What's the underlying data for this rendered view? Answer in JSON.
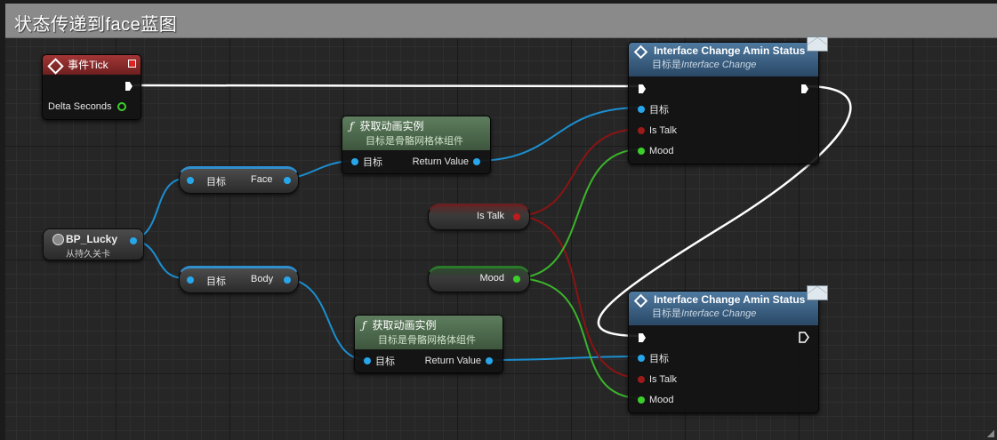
{
  "comment": {
    "title": "状态传递到face蓝图"
  },
  "event_tick": {
    "title": "事件Tick",
    "delta_label": "Delta Seconds"
  },
  "bp_lucky": {
    "name": "BP_Lucky",
    "subtitle": "从持久关卡"
  },
  "face_getter": {
    "target_label": "目标",
    "output_label": "Face"
  },
  "body_getter": {
    "target_label": "目标",
    "output_label": "Body"
  },
  "anim_face": {
    "title": "获取动画实例",
    "subtitle": "目标是骨骼网格体组件",
    "target_label": "目标",
    "return_label": "Return Value"
  },
  "anim_body": {
    "title": "获取动画实例",
    "subtitle": "目标是骨骼网格体组件",
    "target_label": "目标",
    "return_label": "Return Value"
  },
  "is_talk_var": {
    "label": "Is Talk"
  },
  "mood_var": {
    "label": "Mood"
  },
  "iface_top": {
    "title": "Interface Change Amin Status",
    "subtitle_prefix": "目标是",
    "subtitle_target": "Interface Change",
    "pins": {
      "target": "目标",
      "is_talk": "Is Talk",
      "mood": "Mood"
    }
  },
  "iface_bottom": {
    "title": "Interface Change Amin Status",
    "subtitle_prefix": "目标是",
    "subtitle_target": "Interface Change",
    "pins": {
      "target": "目标",
      "is_talk": "Is Talk",
      "mood": "Mood"
    }
  },
  "icons": {
    "function": "function-icon",
    "interface": "interface-icon",
    "message": "envelope-icon",
    "event": "event-icon",
    "actor": "actor-icon"
  },
  "colors": {
    "exec": "#ffffff",
    "object_pin": "#27a7ea",
    "bool_pin": "#9b1b1b",
    "int_pin": "#3ccf2c",
    "event_header": "#a33636",
    "function_header": "#5e7d5e",
    "message_header": "#4f7aa0",
    "comment_header": "#8a8a8a"
  }
}
